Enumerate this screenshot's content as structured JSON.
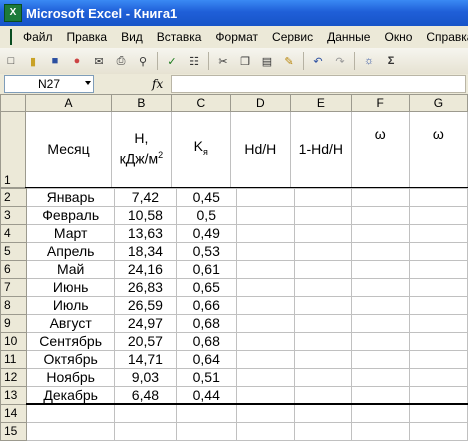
{
  "window": {
    "title": "Microsoft Excel - Книга1"
  },
  "menu": [
    "Файл",
    "Правка",
    "Вид",
    "Вставка",
    "Формат",
    "Сервис",
    "Данные",
    "Окно",
    "Справка"
  ],
  "toolbar": {
    "icons": [
      "new-icon",
      "open-icon",
      "save-icon",
      "permission-icon",
      "email-icon",
      "print-icon",
      "print-preview-icon",
      "spelling-icon",
      "research-icon",
      "cut-icon",
      "copy-icon",
      "paste-icon",
      "format-painter-icon",
      "undo-icon",
      "redo-icon",
      "hyperlink-icon",
      "autosum-icon"
    ]
  },
  "formula_bar": {
    "name_box": "N27",
    "fx": "fx",
    "value": ""
  },
  "columns": [
    "A",
    "B",
    "C",
    "D",
    "E",
    "F",
    "G"
  ],
  "header_row": {
    "row_num": "1",
    "month": "Месяц",
    "H_line1": "H,",
    "H_line2": "кДж/м",
    "H_sup": "2",
    "K_main": "K",
    "K_sub": "я",
    "d": "Hd/H",
    "e": "1-Hd/H",
    "f": "ω",
    "g": "ω"
  },
  "rows": [
    {
      "n": "2",
      "month": "Январь",
      "h": "7,42",
      "k": "0,45"
    },
    {
      "n": "3",
      "month": "Февраль",
      "h": "10,58",
      "k": "0,5"
    },
    {
      "n": "4",
      "month": "Март",
      "h": "13,63",
      "k": "0,49"
    },
    {
      "n": "5",
      "month": "Апрель",
      "h": "18,34",
      "k": "0,53"
    },
    {
      "n": "6",
      "month": "Май",
      "h": "24,16",
      "k": "0,61"
    },
    {
      "n": "7",
      "month": "Июнь",
      "h": "26,83",
      "k": "0,65"
    },
    {
      "n": "8",
      "month": "Июль",
      "h": "26,59",
      "k": "0,66"
    },
    {
      "n": "9",
      "month": "Август",
      "h": "24,97",
      "k": "0,68"
    },
    {
      "n": "10",
      "month": "Сентябрь",
      "h": "20,57",
      "k": "0,68"
    },
    {
      "n": "11",
      "month": "Октябрь",
      "h": "14,71",
      "k": "0,64"
    },
    {
      "n": "12",
      "month": "Ноябрь",
      "h": "9,03",
      "k": "0,51"
    },
    {
      "n": "13",
      "month": "Декабрь",
      "h": "6,48",
      "k": "0,44"
    }
  ],
  "empty_rows": [
    "14",
    "15"
  ]
}
